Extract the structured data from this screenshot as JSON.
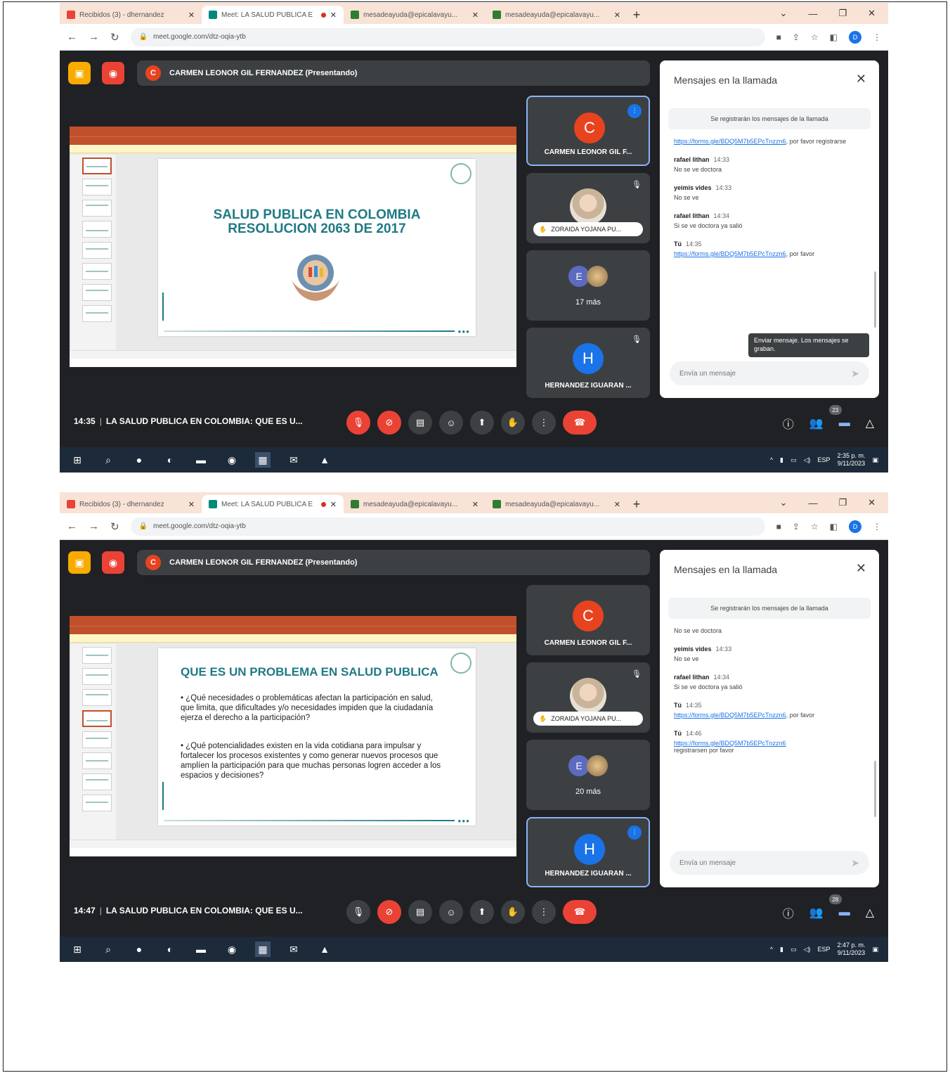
{
  "browser": {
    "tabs": [
      {
        "label": "Recibidos (3) - dhernandez",
        "favicon_color": "#ea4335"
      },
      {
        "label": "Meet: LA SALUD PUBLICA E",
        "favicon_color": "#00897b"
      },
      {
        "label": "mesadeayuda@epicalavayu...",
        "favicon_color": "#2e7d32"
      },
      {
        "label": "mesadeayuda@epicalavayu...",
        "favicon_color": "#2e7d32"
      }
    ],
    "url": "meet.google.com/dtz-oqia-ytb",
    "profile_initial": "D"
  },
  "presenter_bar": {
    "initial": "C",
    "label": "CARMEN LEONOR GIL FERNANDEZ (Presentando)"
  },
  "chat": {
    "title": "Mensajes en la llamada",
    "notice": "Se registrarán los mensajes de la llamada",
    "input_placeholder": "Envía un mensaje",
    "tooltip": "Enviar mensaje. Los mensajes se graban."
  },
  "shots": [
    {
      "slide": {
        "title_line1": "SALUD PUBLICA EN COLOMBIA",
        "title_line2": "RESOLUCION 2063 DE 2017"
      },
      "tiles": [
        {
          "initial": "C",
          "name": "CARMEN LEONOR GIL F..."
        },
        {
          "name": "ZORAIDA YOJANA PU..."
        },
        {
          "initial": "E",
          "count": "17 más"
        },
        {
          "initial": "H",
          "name": "HERNANDEZ IGUARAN ..."
        }
      ],
      "messages": [
        {
          "sender": "",
          "time": "",
          "link": "https://forms.gle/BDQ5M7b5EPcTnzzn6",
          "text": ", por favor registrarse"
        },
        {
          "sender": "rafael lithan",
          "time": "14:33",
          "text": "No se ve doctora"
        },
        {
          "sender": "yeimis vides",
          "time": "14:33",
          "text": "No se ve"
        },
        {
          "sender": "rafael lithan",
          "time": "14:34",
          "text": "Si se ve doctora ya salió"
        },
        {
          "sender": "Tú",
          "time": "14:35",
          "link": "https://forms.gle/BDQ5M7b5EPcTnzzn6",
          "text": ", por favor"
        }
      ],
      "meeting_time": "14:35",
      "meeting_title": "LA SALUD PUBLICA EN COLOMBIA: QUE ES U...",
      "people_badge": "23",
      "clock_time": "2:35 p. m.",
      "clock_date": "9/11/2023"
    },
    {
      "slide": {
        "heading": "QUE ES UN PROBLEMA EN SALUD PUBLICA",
        "bullet1": "• ¿Qué necesidades o problemáticas afectan la participación en salud, que limita, que dificultades y/o necesidades impiden que la ciudadanía ejerza el derecho a la participación?",
        "bullet2": "• ¿Qué potencialidades existen en la vida cotidiana para impulsar y fortalecer los procesos existentes y como generar nuevos procesos que amplíen la participación para que muchas personas logren acceder a los espacios y decisiones?"
      },
      "tiles": [
        {
          "initial": "C",
          "name": "CARMEN LEONOR GIL F..."
        },
        {
          "name": "ZORAIDA YOJANA PU..."
        },
        {
          "initial": "E",
          "count": "20 más"
        },
        {
          "initial": "H",
          "name": "HERNANDEZ IGUARAN ..."
        }
      ],
      "messages": [
        {
          "sender": "",
          "time": "",
          "text": "No se ve doctora"
        },
        {
          "sender": "yeimis vides",
          "time": "14:33",
          "text": "No se ve"
        },
        {
          "sender": "rafael lithan",
          "time": "14:34",
          "text": "Si se ve doctora ya salió"
        },
        {
          "sender": "Tú",
          "time": "14:35",
          "link": "https://forms.gle/BDQ5M7b5EPcTnzzn6",
          "text": ", por favor"
        },
        {
          "sender": "Tú",
          "time": "14:46",
          "link": "https://forms.gle/BDQ5M7b5EPcTnzzn6",
          "text": "registrarsen por favor"
        }
      ],
      "meeting_time": "14:47",
      "meeting_title": "LA SALUD PUBLICA EN COLOMBIA: QUE ES U...",
      "people_badge": "28",
      "clock_time": "2:47 p. m.",
      "clock_date": "9/11/2023"
    }
  ],
  "taskbar": {
    "lang": "ESP"
  },
  "colors": {
    "meet_bg": "#202124",
    "tile_bg": "#3c4043",
    "danger": "#ea4335",
    "accent": "#1a73e8",
    "slide_text": "#1f7a85"
  }
}
